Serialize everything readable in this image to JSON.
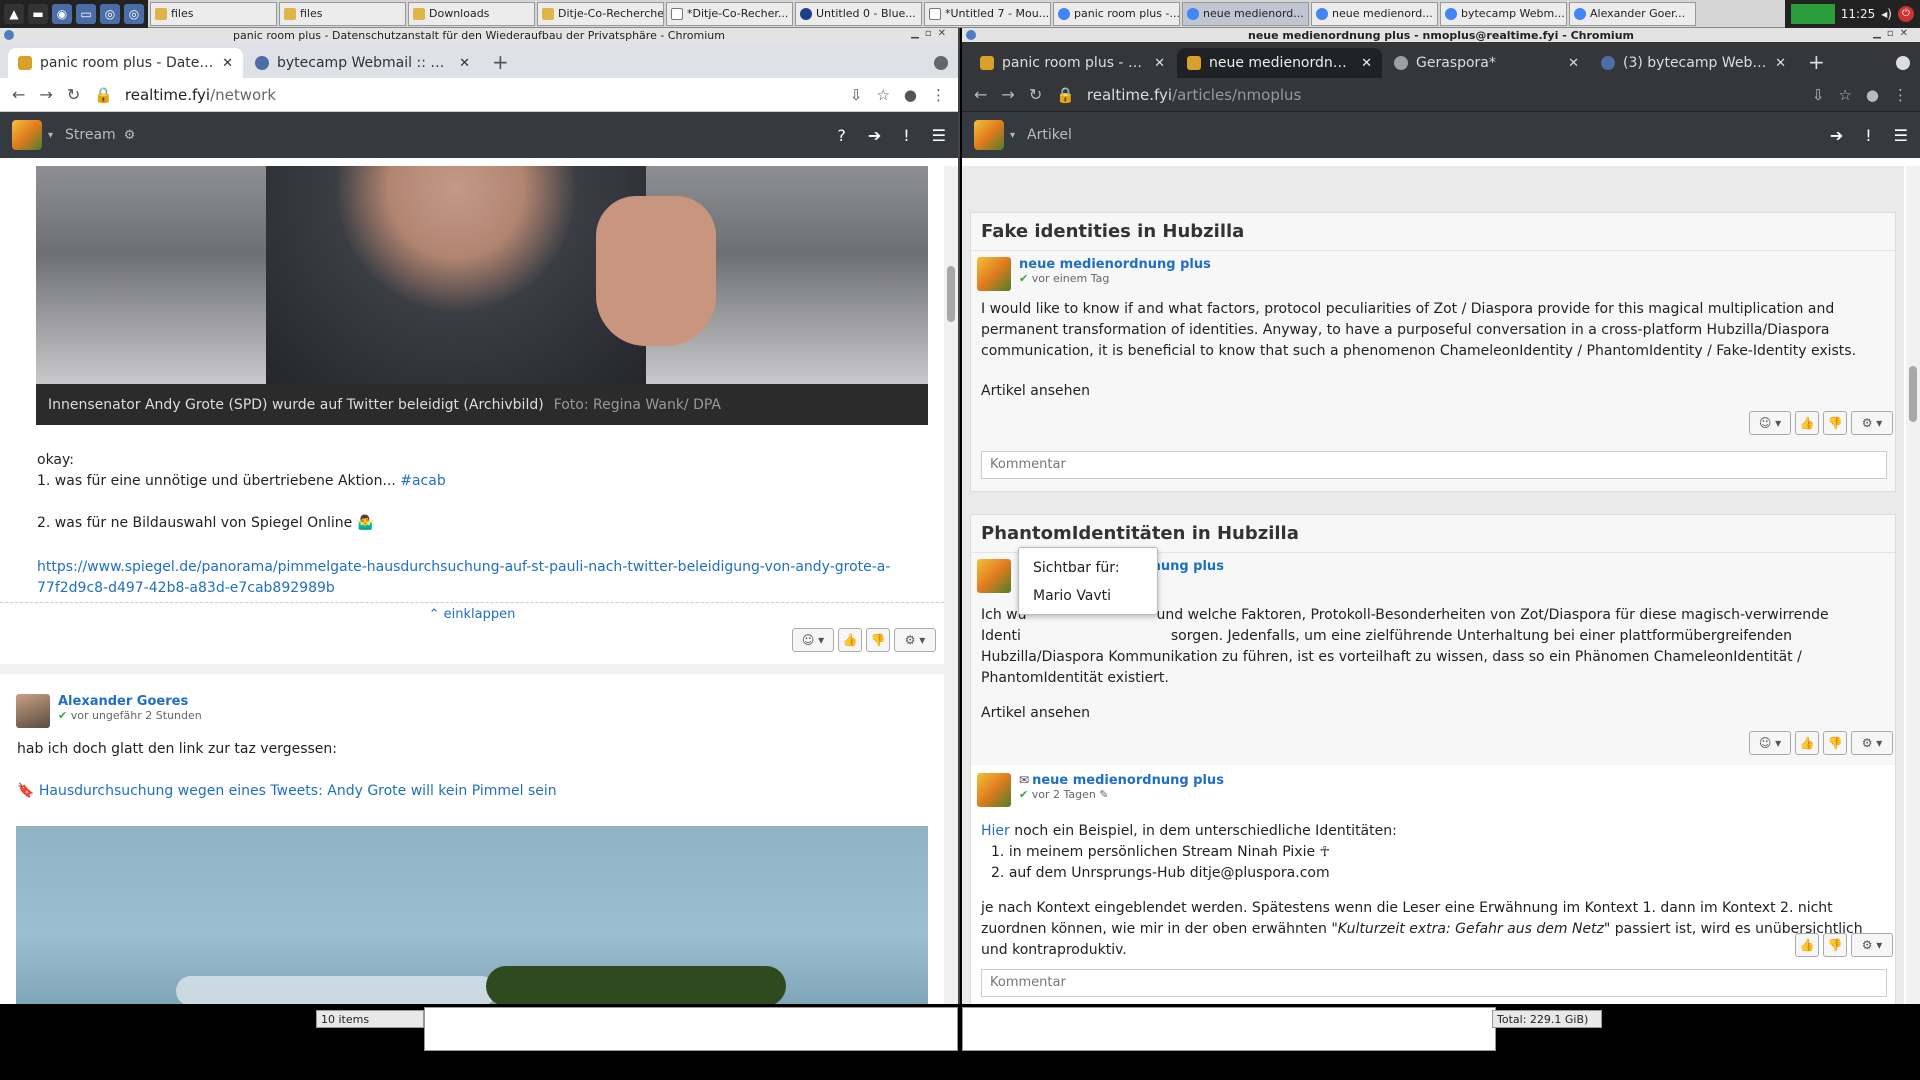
{
  "taskbar": {
    "windows": [
      {
        "label": "files",
        "icon": "folder-icon"
      },
      {
        "label": "files",
        "icon": "folder-icon"
      },
      {
        "label": "Downloads",
        "icon": "folder-icon"
      },
      {
        "label": "Ditje-Co-Recherche",
        "icon": "folder-icon"
      },
      {
        "label": "*Ditje-Co-Recher...",
        "icon": "text-editor-icon"
      },
      {
        "label": "Untitled 0 - Blue...",
        "icon": "bluefish-icon"
      },
      {
        "label": "*Untitled 7 - Mou...",
        "icon": "text-editor-icon"
      },
      {
        "label": "panic room plus -...",
        "icon": "chromium-icon"
      },
      {
        "label": "neue medienord...",
        "icon": "chromium-icon"
      },
      {
        "label": "neue medienord...",
        "icon": "chromium-icon"
      },
      {
        "label": "bytecamp Webm...",
        "icon": "chromium-icon"
      },
      {
        "label": "Alexander Goer...",
        "icon": "chromium-icon"
      }
    ],
    "clock": "11:25"
  },
  "left": {
    "window_title": "panic room plus - Datenschutzanstalt für den Wiederaufbau der Privatsphäre - Chromium",
    "tabs": [
      {
        "label": "panic room plus - Datensc",
        "active": true
      },
      {
        "label": "bytecamp Webmail :: Willk",
        "active": false
      }
    ],
    "url_host": "realtime.fyi",
    "url_path": "/network",
    "site_nav": {
      "label": "Stream"
    },
    "caption": {
      "text": "Innensenator Andy Grote (SPD) wurde auf Twitter beleidigt (Archivbild)",
      "credit": "Foto: Regina Wank/ DPA"
    },
    "post": {
      "line1": "okay:",
      "line2_prefix": "1. was für eine unnötige und übertriebene Aktion... ",
      "line2_tag": "#acab",
      "line3": "2. was für ne Bildauswahl von Spiegel Online 🤷‍♂",
      "link_line1": "https://www.spiegel.de/panorama/pimmelgate-hausdurchsuchung-auf-st-pauli-nach-twitter-beleidigung-von-andy-grote-a-",
      "link_line2": "77f2d9c8-d497-42b8-a83d-e7cab892989b"
    },
    "collapse_label": "einklappen",
    "reply": {
      "author": "Alexander Goeres",
      "time": "vor ungefähr 2 Stunden",
      "text": "hab ich doch glatt den link zur taz vergessen:",
      "link": "Hausdurchsuchung wegen eines Tweets: Andy Grote will kein Pimmel sein"
    }
  },
  "right": {
    "window_title": "neue medienordnung plus - nmoplus@realtime.fyi - Chromium",
    "tabs": [
      {
        "label": "panic room plus - Dat",
        "active": false
      },
      {
        "label": "neue medienordnung",
        "active": true
      },
      {
        "label": "Geraspora*",
        "active": false
      },
      {
        "label": "(3) bytecamp Webma",
        "active": false
      }
    ],
    "url_host": "realtime.fyi",
    "url_path": "/articles/nmoplus",
    "site_nav": {
      "label": "Artikel"
    },
    "article1": {
      "title": "Fake identities in Hubzilla",
      "author": "neue medienordnung plus",
      "time": "vor einem Tag",
      "body": "I would like to know if and what factors, protocol peculiarities of Zot / Diaspora provide for this magical multiplication and permanent transformation of identities. Anyway, to have a purposeful conversation in a cross-platform Hubzilla/Diaspora communication, it is beneficial to know that such a phenomenon ChameleonIdentity / PhantomIdentity / Fake-Identity exists.",
      "link": "Artikel ansehen",
      "comment_placeholder": "Kommentar"
    },
    "article2": {
      "title": "PhantomIdentitäten in Hubzilla",
      "author": "neue medienordnung plus",
      "body_line1_a": "Ich wü",
      "body_line1_b": "und welche Faktoren, Protokoll-Besonderheiten von Zot/Diaspora für diese magisch-verwirrende",
      "body_line2_a": "Identi",
      "body_line2_b": "sorgen. Jedenfalls, um eine zielführende Unterhaltung bei einer plattformübergreifenden",
      "body_line3": "Hubzilla/Diaspora Kommunikation zu führen, ist es vorteilhaft zu wissen, dass so ein Phänomen ChameleonIdentität /",
      "body_line4": "PhantomIdentität existiert.",
      "link": "Artikel ansehen"
    },
    "popup": {
      "line1": "Sichtbar für:",
      "line2": "Mario Vavti"
    },
    "comment1": {
      "author": "neue medienordnung plus",
      "time": "vor 2 Tagen",
      "intro_link": "Hier",
      "intro_rest": " noch ein Beispiel, in dem unterschiedliche Identitäten:",
      "item1": "in meinem persönlichen Stream Ninah Pixie ☥",
      "item2": "auf dem Unrsprungs-Hub ditje@pluspora.com",
      "para_a": "je nach Kontext eingeblendet werden. Spätestens wenn die Leser  eine Erwähnung im Kontext 1. dann im Kontext 2. nicht zuordnen können, wie mir in der oben erwähnten \"",
      "para_em": "Kulturzeit extra: Gefahr aus dem Netz",
      "para_b": "\" passiert ist, wird es unübersichtlich und kontraproduktiv.",
      "comment_placeholder": "Kommentar"
    }
  },
  "bottom": {
    "items_label": "10 items",
    "total_label": "Total: 229.1 GiB)"
  }
}
